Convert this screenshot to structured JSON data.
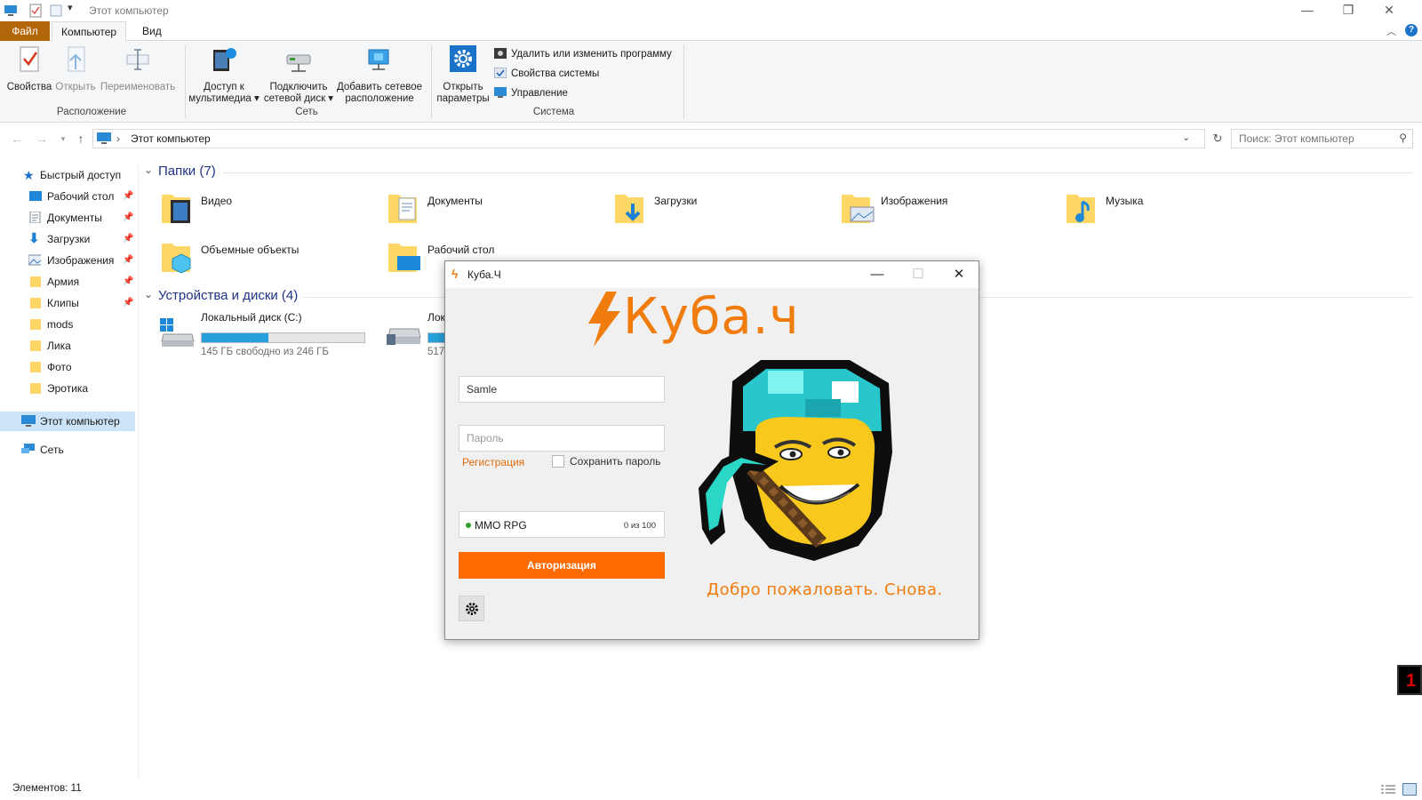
{
  "window": {
    "title": "Этот компьютер"
  },
  "tabs": {
    "file": "Файл",
    "computer": "Компьютер",
    "view": "Вид"
  },
  "ribbon": {
    "properties": "Свойства",
    "open": "Открыть",
    "rename": "Переименовать",
    "group_location": "Расположение",
    "media_access_1": "Доступ к",
    "media_access_2": "мультимедиа ▾",
    "map_drive_1": "Подключить",
    "map_drive_2": "сетевой диск ▾",
    "add_location_1": "Добавить сетевое",
    "add_location_2": "расположение",
    "group_network": "Сеть",
    "open_settings_1": "Открыть",
    "open_settings_2": "параметры",
    "uninstall": "Удалить или изменить программу",
    "system_props": "Свойства системы",
    "manage": "Управление",
    "group_system": "Система"
  },
  "address": {
    "path": "Этот компьютер",
    "search_placeholder": "Поиск: Этот компьютер"
  },
  "sidebar": {
    "quick_access": "Быстрый доступ",
    "items": [
      {
        "label": "Рабочий стол",
        "pinned": true
      },
      {
        "label": "Документы",
        "pinned": true
      },
      {
        "label": "Загрузки",
        "pinned": true
      },
      {
        "label": "Изображения",
        "pinned": true
      },
      {
        "label": "Армия",
        "pinned": true
      },
      {
        "label": "Клипы",
        "pinned": true
      },
      {
        "label": "mods",
        "pinned": false
      },
      {
        "label": "Лика",
        "pinned": false
      },
      {
        "label": "Фото",
        "pinned": false
      },
      {
        "label": "Эротика",
        "pinned": false
      }
    ],
    "this_pc": "Этот компьютер",
    "network": "Сеть"
  },
  "content": {
    "folders_header": "Папки (7)",
    "folders": [
      "Видео",
      "Документы",
      "Загрузки",
      "Изображения",
      "Музыка",
      "Объемные объекты",
      "Рабочий стол"
    ],
    "devices_header": "Устройства и диски (4)",
    "drive_c": {
      "name": "Локальный диск (C:)",
      "free": "145 ГБ свободно из 246 ГБ",
      "used_fraction": 0.41
    },
    "drive_2": {
      "name": "Лок",
      "free": "517"
    }
  },
  "status": {
    "items": "Элементов: 11"
  },
  "launcher": {
    "title": "Куба.Ч",
    "logo": "Куба.ч",
    "login_value": "Samle",
    "password_placeholder": "Пароль",
    "register": "Регистрация",
    "save_password": "Сохранить пароль",
    "server_name": "MMO RPG",
    "server_count": "0 из 100",
    "auth_button": "Авторизация",
    "welcome": "Добро пожаловать. Снова.",
    "accent": "#ff6a00"
  },
  "tray_badge": "1"
}
